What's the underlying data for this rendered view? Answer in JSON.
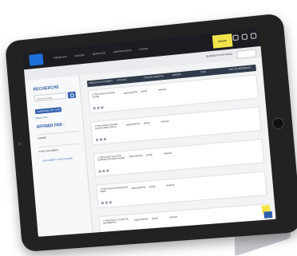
{
  "topbar": {
    "nav": [
      "PRODUITS",
      "GUIDES",
      "SERVICES",
      "INSPIRATIONS",
      "KNAUF"
    ],
    "brand_badge": "KNAUF"
  },
  "subbar": {
    "link": "ÉLÉMENTS PAR PAGE :"
  },
  "sidebar": {
    "title": "RECHERCHE",
    "search_placeholder": "Saisir le produit...",
    "active_tag": "COMPATIBILITÉ TYPE",
    "clear_link": "Effacer tout",
    "filter_title": "AFFINER PAR :",
    "filter_1": "GAMME",
    "filter_2": "TYPE DOCUMENT",
    "filter_3": "DOCUMENT TYPE FOLDER"
  },
  "table": {
    "headers": [
      "LIBELLÉ DU DOCUMENT",
      "TYPE DOC.",
      "DATE DE CRÉATION",
      "MARQUE",
      "TYPE",
      "ÉTAT DE RÉFÉRENCE"
    ],
    "rows": [
      {
        "title": "CYTRO KNAUF PLAFOND SOLIDE",
        "c2": "DESCRIPTIF",
        "c3": "DATE",
        "c4": "KNAUF"
      },
      {
        "title": "CYTRO KNAUF PLAFOND CLOISON PAROI DALLE",
        "c2": "DESCRIPTIF",
        "c3": "DATE",
        "c4": "KNAUF"
      },
      {
        "title": "CYTRO KNAUF SOLUTION SUPPORT DE POSE PLAQUES",
        "c2": "DESCRIPTIF",
        "c3": "DATE",
        "c4": "KNAUF"
      },
      {
        "title": "CYTRO KNAUF DOUBLAGE DE PAROI",
        "c2": "DESCRIPTIF",
        "c3": "DATE",
        "c4": "KNAUF"
      },
      {
        "title": "CYTRO KNAUF CLOISON DE DISTRIBUTION",
        "c2": "DESCRIPTIF",
        "c3": "DATE",
        "c4": "KNAUF"
      }
    ]
  }
}
